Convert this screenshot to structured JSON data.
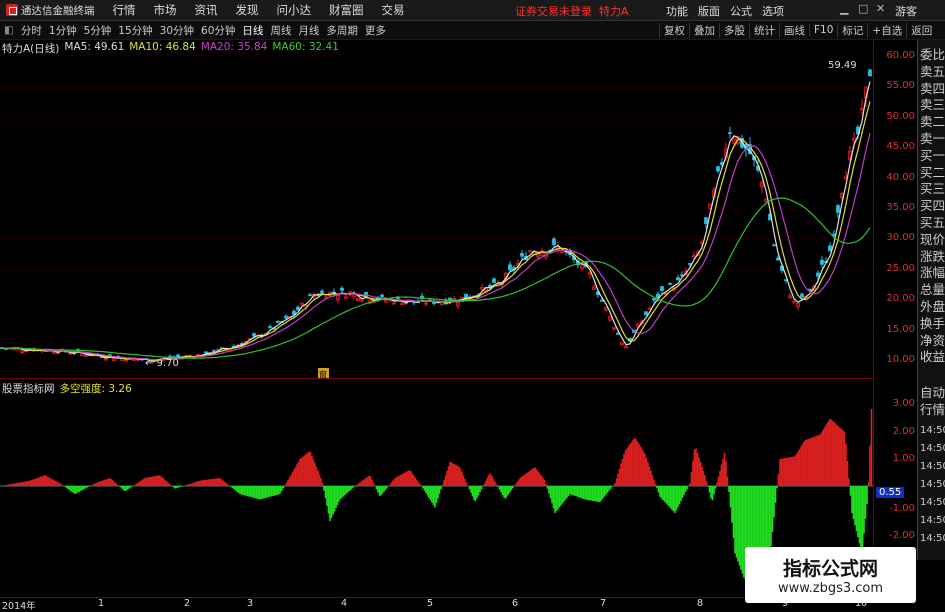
{
  "topbar": {
    "app_name": "通达信金融终端",
    "menu": [
      "行情",
      "市场",
      "资讯",
      "发现",
      "问小达",
      "财富圈",
      "交易"
    ],
    "login_warning": "证券交易未登录",
    "stock_title": "特力A",
    "right_menu": [
      "功能",
      "版面",
      "公式",
      "选项"
    ],
    "guest": "游客"
  },
  "toolbar": {
    "periods": [
      "分时",
      "1分钟",
      "5分钟",
      "15分钟",
      "30分钟",
      "60分钟",
      "日线",
      "周线",
      "月线",
      "多周期",
      "更多"
    ],
    "active": "日线",
    "right_buttons": [
      "复权",
      "叠加",
      "多股",
      "统计",
      "画线",
      "F10",
      "标记",
      "+自选",
      "返回"
    ]
  },
  "price_panel": {
    "title": "特力A(日线)",
    "ma5": "MA5: 49.61",
    "ma10": "MA10: 46.84",
    "ma20": "MA20: 35.84",
    "ma60": "MA60: 32.41",
    "high_label": "59.49",
    "low_label": "9.70",
    "yticks": [
      "60.00",
      "55.00",
      "50.00",
      "45.00",
      "40.00",
      "35.00",
      "30.00",
      "25.00",
      "20.00",
      "15.00",
      "10.00"
    ],
    "colors": {
      "up": "#e02020",
      "down": "#20c0e0",
      "ma5": "#e0e0e0",
      "ma10": "#e0e030",
      "ma20": "#c040c0",
      "ma60": "#30c030"
    }
  },
  "indicator_panel": {
    "name": "股票指标网",
    "label": "多空强度: 3.26",
    "yticks": [
      "3.00",
      "2.00",
      "1.00",
      "-1.00",
      "-2.00"
    ],
    "current_value": "0.55"
  },
  "sidebar": [
    "委比",
    "卖五",
    "卖四",
    "卖三",
    "卖二",
    "卖一",
    "买一",
    "买二",
    "买三",
    "买四",
    "买五",
    "现价",
    "涨跌",
    "涨幅",
    "总量",
    "外盘",
    "换手",
    "净资",
    "收益"
  ],
  "sidebar_bottom": [
    "自动",
    "行情"
  ],
  "sidebar_times": [
    "14:50",
    "14:50",
    "14:50",
    "14:50",
    "14:50",
    "14:50",
    "14:50"
  ],
  "dates": [
    "2014年",
    "1",
    "2",
    "3",
    "4",
    "5",
    "6",
    "7",
    "8",
    "9",
    "10"
  ],
  "watermark": {
    "line1": "指标公式网",
    "line2": "www.zbgs3.com"
  },
  "marker": "窗"
}
